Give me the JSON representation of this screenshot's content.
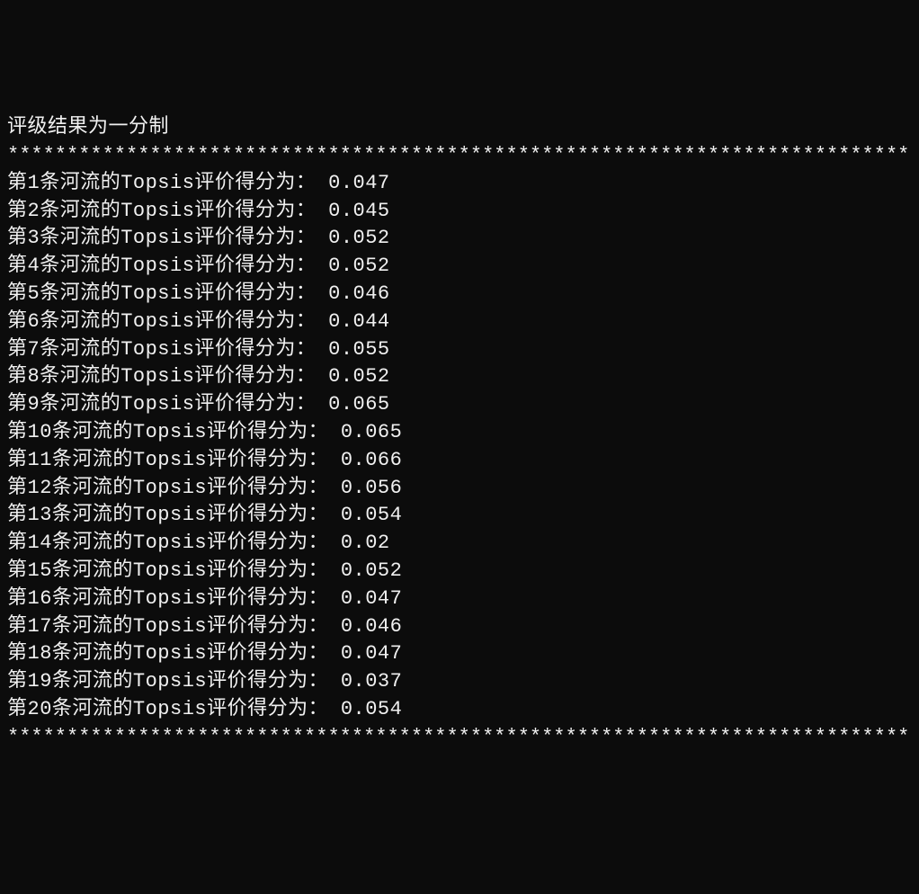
{
  "header": "评级结果为一分制",
  "separator": "*****************************************************************************",
  "label_prefix": "第",
  "label_mid": "条河流的Topsis评价得分为：",
  "results": [
    {
      "index": 1,
      "score": "0.047"
    },
    {
      "index": 2,
      "score": "0.045"
    },
    {
      "index": 3,
      "score": "0.052"
    },
    {
      "index": 4,
      "score": "0.052"
    },
    {
      "index": 5,
      "score": "0.046"
    },
    {
      "index": 6,
      "score": "0.044"
    },
    {
      "index": 7,
      "score": "0.055"
    },
    {
      "index": 8,
      "score": "0.052"
    },
    {
      "index": 9,
      "score": "0.065"
    },
    {
      "index": 10,
      "score": "0.065"
    },
    {
      "index": 11,
      "score": "0.066"
    },
    {
      "index": 12,
      "score": "0.056"
    },
    {
      "index": 13,
      "score": "0.054"
    },
    {
      "index": 14,
      "score": "0.02"
    },
    {
      "index": 15,
      "score": "0.052"
    },
    {
      "index": 16,
      "score": "0.047"
    },
    {
      "index": 17,
      "score": "0.046"
    },
    {
      "index": 18,
      "score": "0.047"
    },
    {
      "index": 19,
      "score": "0.037"
    },
    {
      "index": 20,
      "score": "0.054"
    }
  ]
}
